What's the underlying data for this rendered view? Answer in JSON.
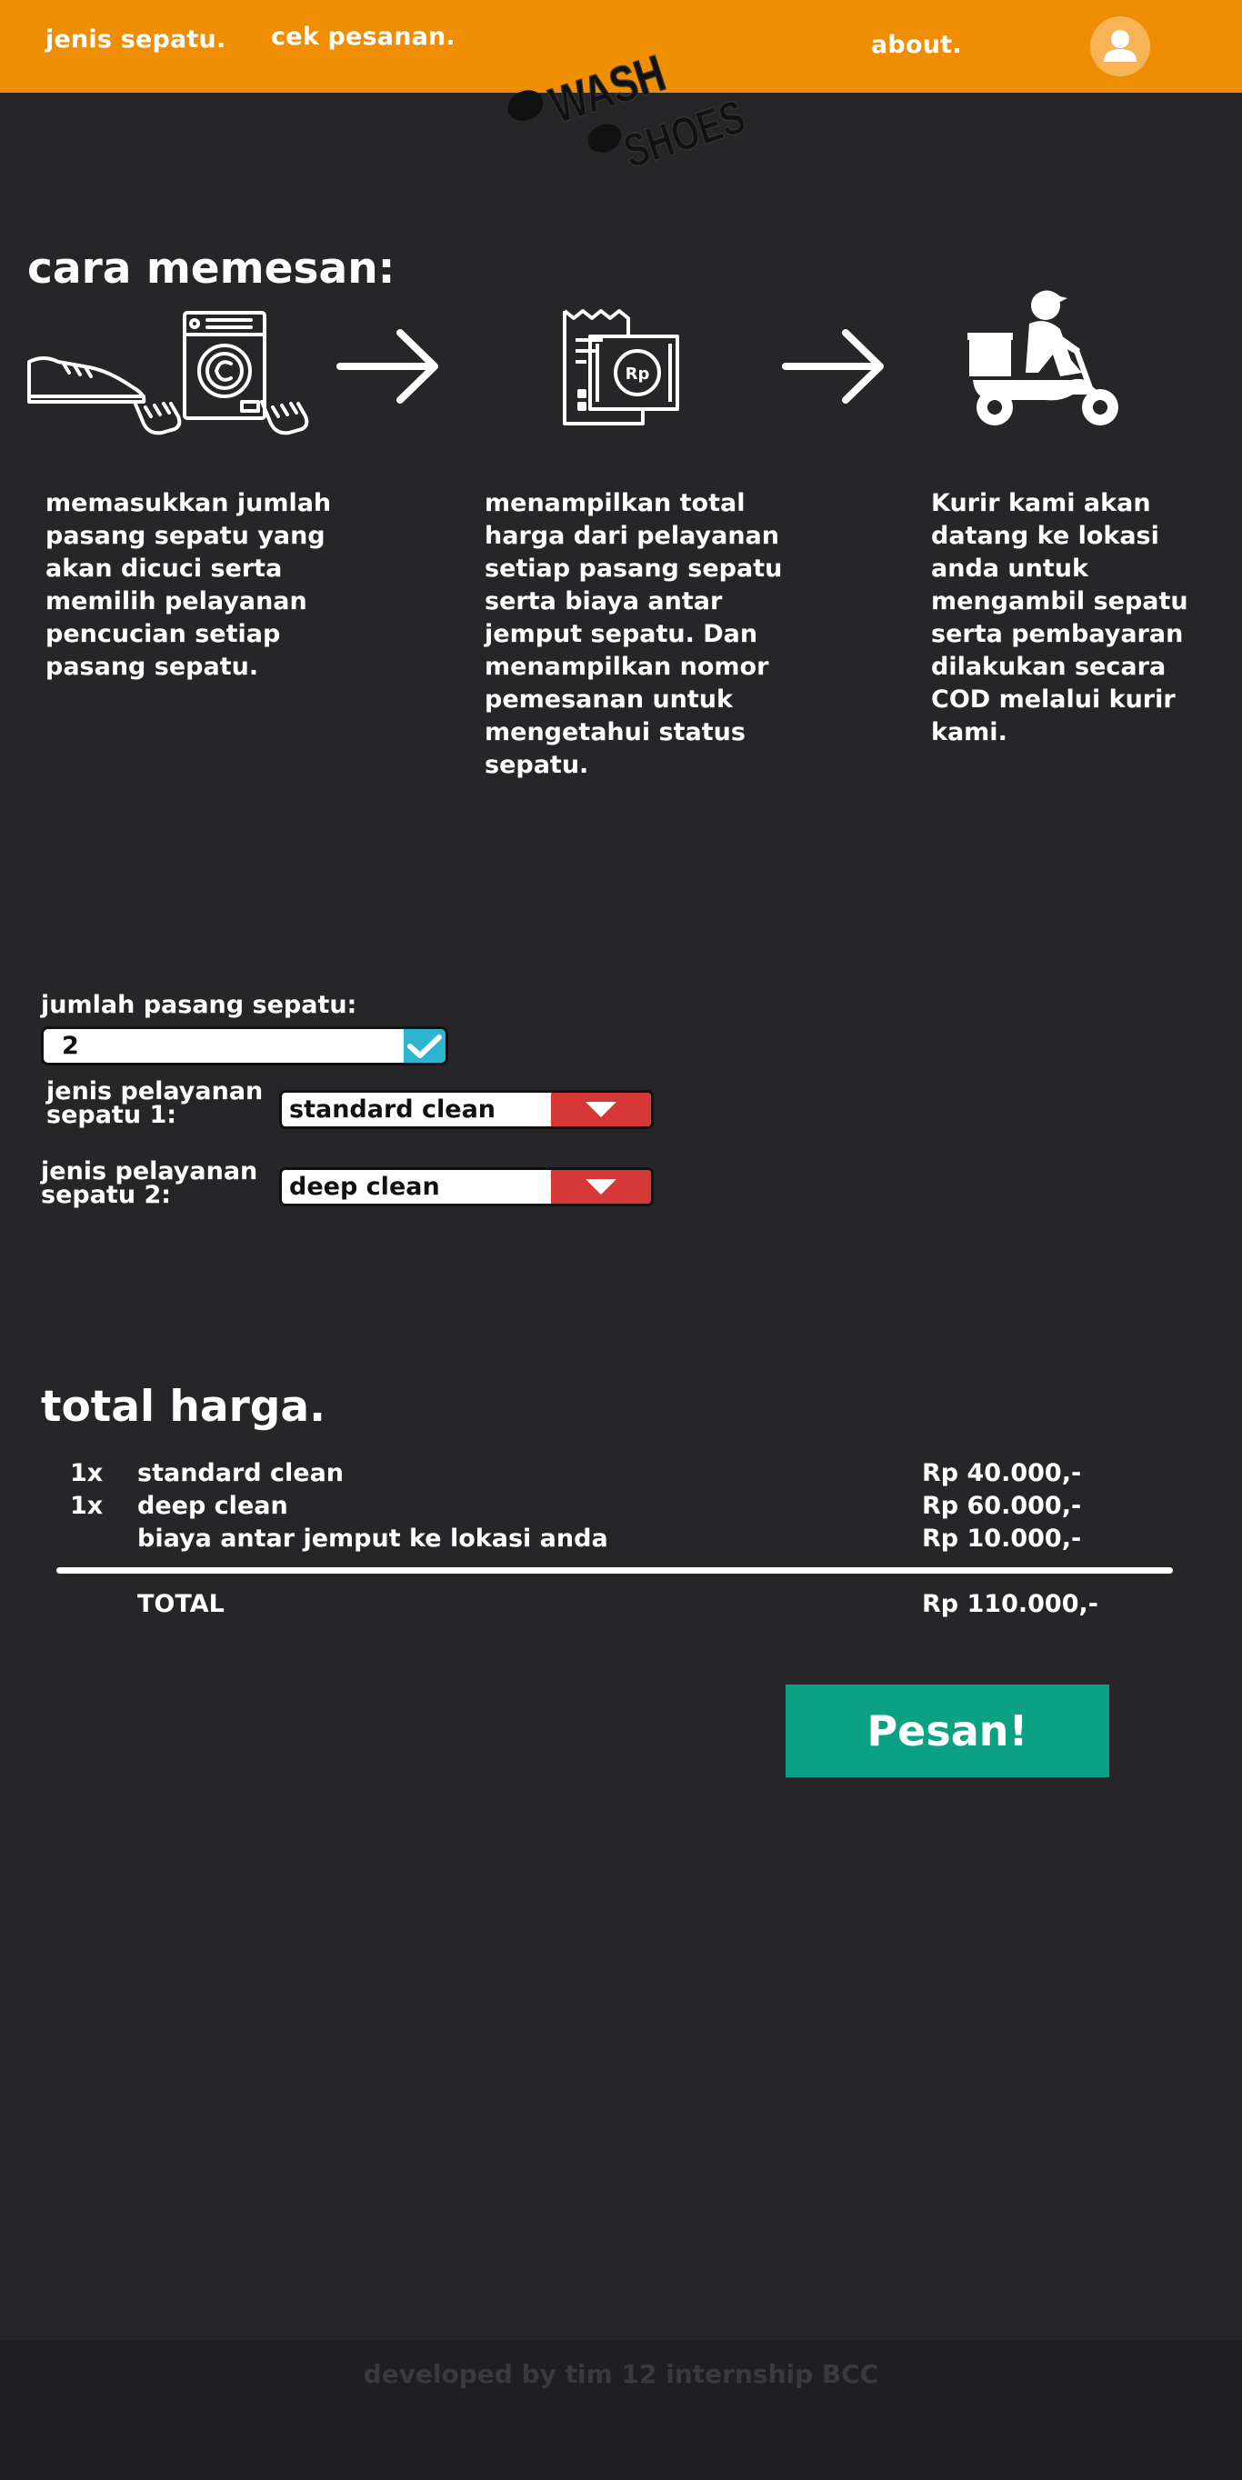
{
  "nav": {
    "jenis_sepatu": "jenis sepatu.",
    "cek_pesanan": "cek pesanan.",
    "about": "about.",
    "logo_line1": "WASH",
    "logo_line2": "SHOES",
    "avatar_icon": "user-icon"
  },
  "how_to_order": {
    "title": "cara memesan:",
    "steps": [
      {
        "icon": "shoe-washing-machine-icon",
        "lines": [
          "memasukkan jumlah",
          "pasang sepatu yang",
          "akan dicuci serta",
          "memilih pelayanan",
          "pencucian setiap",
          "pasang sepatu."
        ]
      },
      {
        "icon": "receipt-money-icon",
        "lines": [
          "menampilkan total",
          "harga dari pelayanan",
          "setiap pasang sepatu",
          "serta biaya antar",
          "jemput sepatu. Dan",
          "menampilkan nomor",
          "pemesanan untuk",
          "mengetahui status",
          "sepatu."
        ]
      },
      {
        "icon": "courier-scooter-icon",
        "lines": [
          "Kurir kami akan",
          "datang ke lokasi",
          "anda untuk",
          "mengambil sepatu",
          "serta pembayaran",
          "dilakukan secara",
          "COD melalui kurir",
          "kami."
        ]
      }
    ],
    "arrow_icon": "arrow-right-icon",
    "money_label": "Rp"
  },
  "form": {
    "qty_label": "jumlah  pasang sepatu:",
    "qty_value": "2",
    "service1_label_line1": "jenis pelayanan",
    "service1_label_line2": "sepatu 1:",
    "service1_value": "standard clean",
    "service2_label_line1": "jenis pelayanan",
    "service2_label_line2": "sepatu 2:",
    "service2_value": "deep clean"
  },
  "total": {
    "title": "total harga.",
    "items": [
      {
        "qty": "1x",
        "name": "standard clean",
        "price": "Rp 40.000,-"
      },
      {
        "qty": "1x",
        "name": "deep clean",
        "price": "Rp 60.000,-"
      },
      {
        "qty": "",
        "name": "biaya antar jemput ke lokasi anda",
        "price": "Rp 10.000,-"
      }
    ],
    "total_label": "TOTAL",
    "total_value": "Rp 110.000,-"
  },
  "order_button": "Pesan!",
  "footer": "developed by tim 12 internship BCC",
  "colors": {
    "header": "#ef8e02",
    "background": "#262527",
    "check_button": "#2db4cf",
    "dropdown_button": "#d63838",
    "order_button": "#0aa283"
  }
}
